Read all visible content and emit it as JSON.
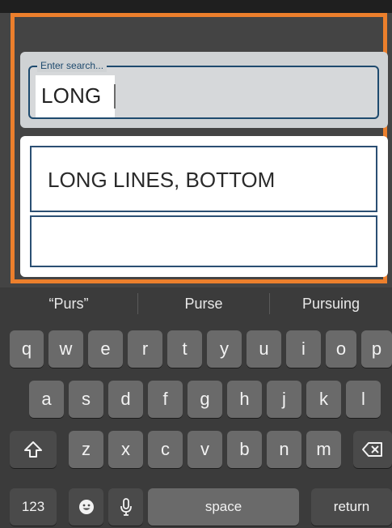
{
  "search": {
    "legend": "Enter search...",
    "value": "LONG "
  },
  "results": [
    {
      "label": "LONG LINES, BOTTOM"
    },
    {
      "label": ""
    }
  ],
  "suggestions": [
    "“Purs”",
    "Purse",
    "Pursuing"
  ],
  "keyboard": {
    "row1": [
      "q",
      "w",
      "e",
      "r",
      "t",
      "y",
      "u",
      "i",
      "o",
      "p"
    ],
    "row2": [
      "a",
      "s",
      "d",
      "f",
      "g",
      "h",
      "j",
      "k",
      "l"
    ],
    "row3": [
      "z",
      "x",
      "c",
      "v",
      "b",
      "n",
      "m"
    ],
    "numbers_label": "123",
    "space_label": "space",
    "return_label": "return",
    "icons": {
      "shift": "shift-icon",
      "delete": "delete-icon",
      "emoji": "emoji-icon",
      "mic": "microphone-icon"
    }
  },
  "colors": {
    "highlight": "#ec7f2c",
    "field_border": "#1e4a6e",
    "key": "#6a6a6a",
    "key_dark": "#4a4a4a"
  }
}
